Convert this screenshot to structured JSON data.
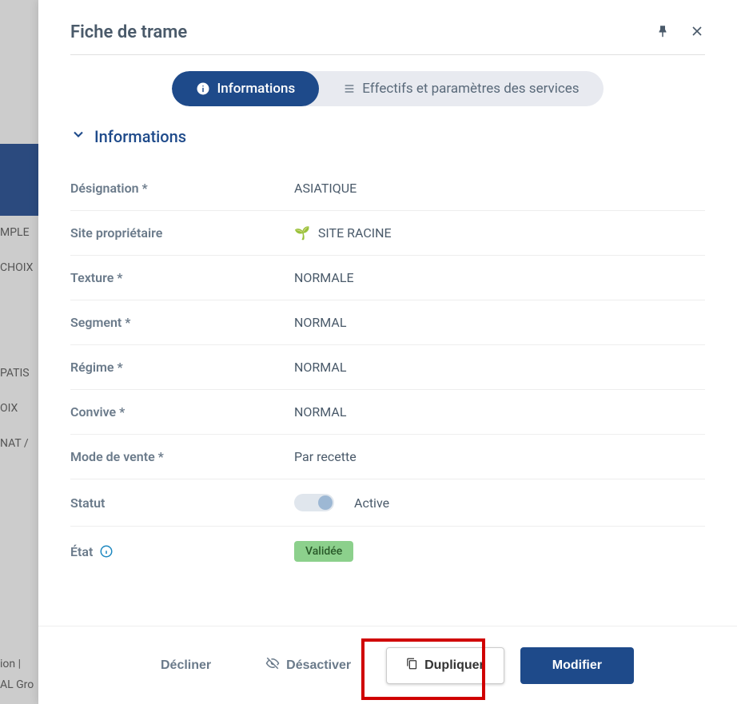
{
  "modal": {
    "title": "Fiche de trame",
    "tabs": {
      "informations": "Informations",
      "effectifs": "Effectifs et paramètres des services"
    },
    "section_title": "Informations",
    "fields": {
      "designation": {
        "label": "Désignation *",
        "value": "ASIATIQUE"
      },
      "site": {
        "label": "Site propriétaire",
        "value": "SITE RACINE"
      },
      "texture": {
        "label": "Texture *",
        "value": "NORMALE"
      },
      "segment": {
        "label": "Segment *",
        "value": "NORMAL"
      },
      "regime": {
        "label": "Régime *",
        "value": "NORMAL"
      },
      "convive": {
        "label": "Convive *",
        "value": "NORMAL"
      },
      "mode_vente": {
        "label": "Mode de vente *",
        "value": "Par recette"
      },
      "statut": {
        "label": "Statut",
        "value": "Active"
      },
      "etat": {
        "label": "État",
        "value": "Validée"
      }
    },
    "buttons": {
      "decline": "Décliner",
      "deactivate": "Désactiver",
      "duplicate": "Dupliquer",
      "modify": "Modifier"
    }
  },
  "background": {
    "item1": "MPLE",
    "item2": "CHOIX",
    "item3": "PATIS",
    "item4": "OIX",
    "item5": "NAT /",
    "footer1": "ion  |",
    "footer2": "AL Gro"
  }
}
